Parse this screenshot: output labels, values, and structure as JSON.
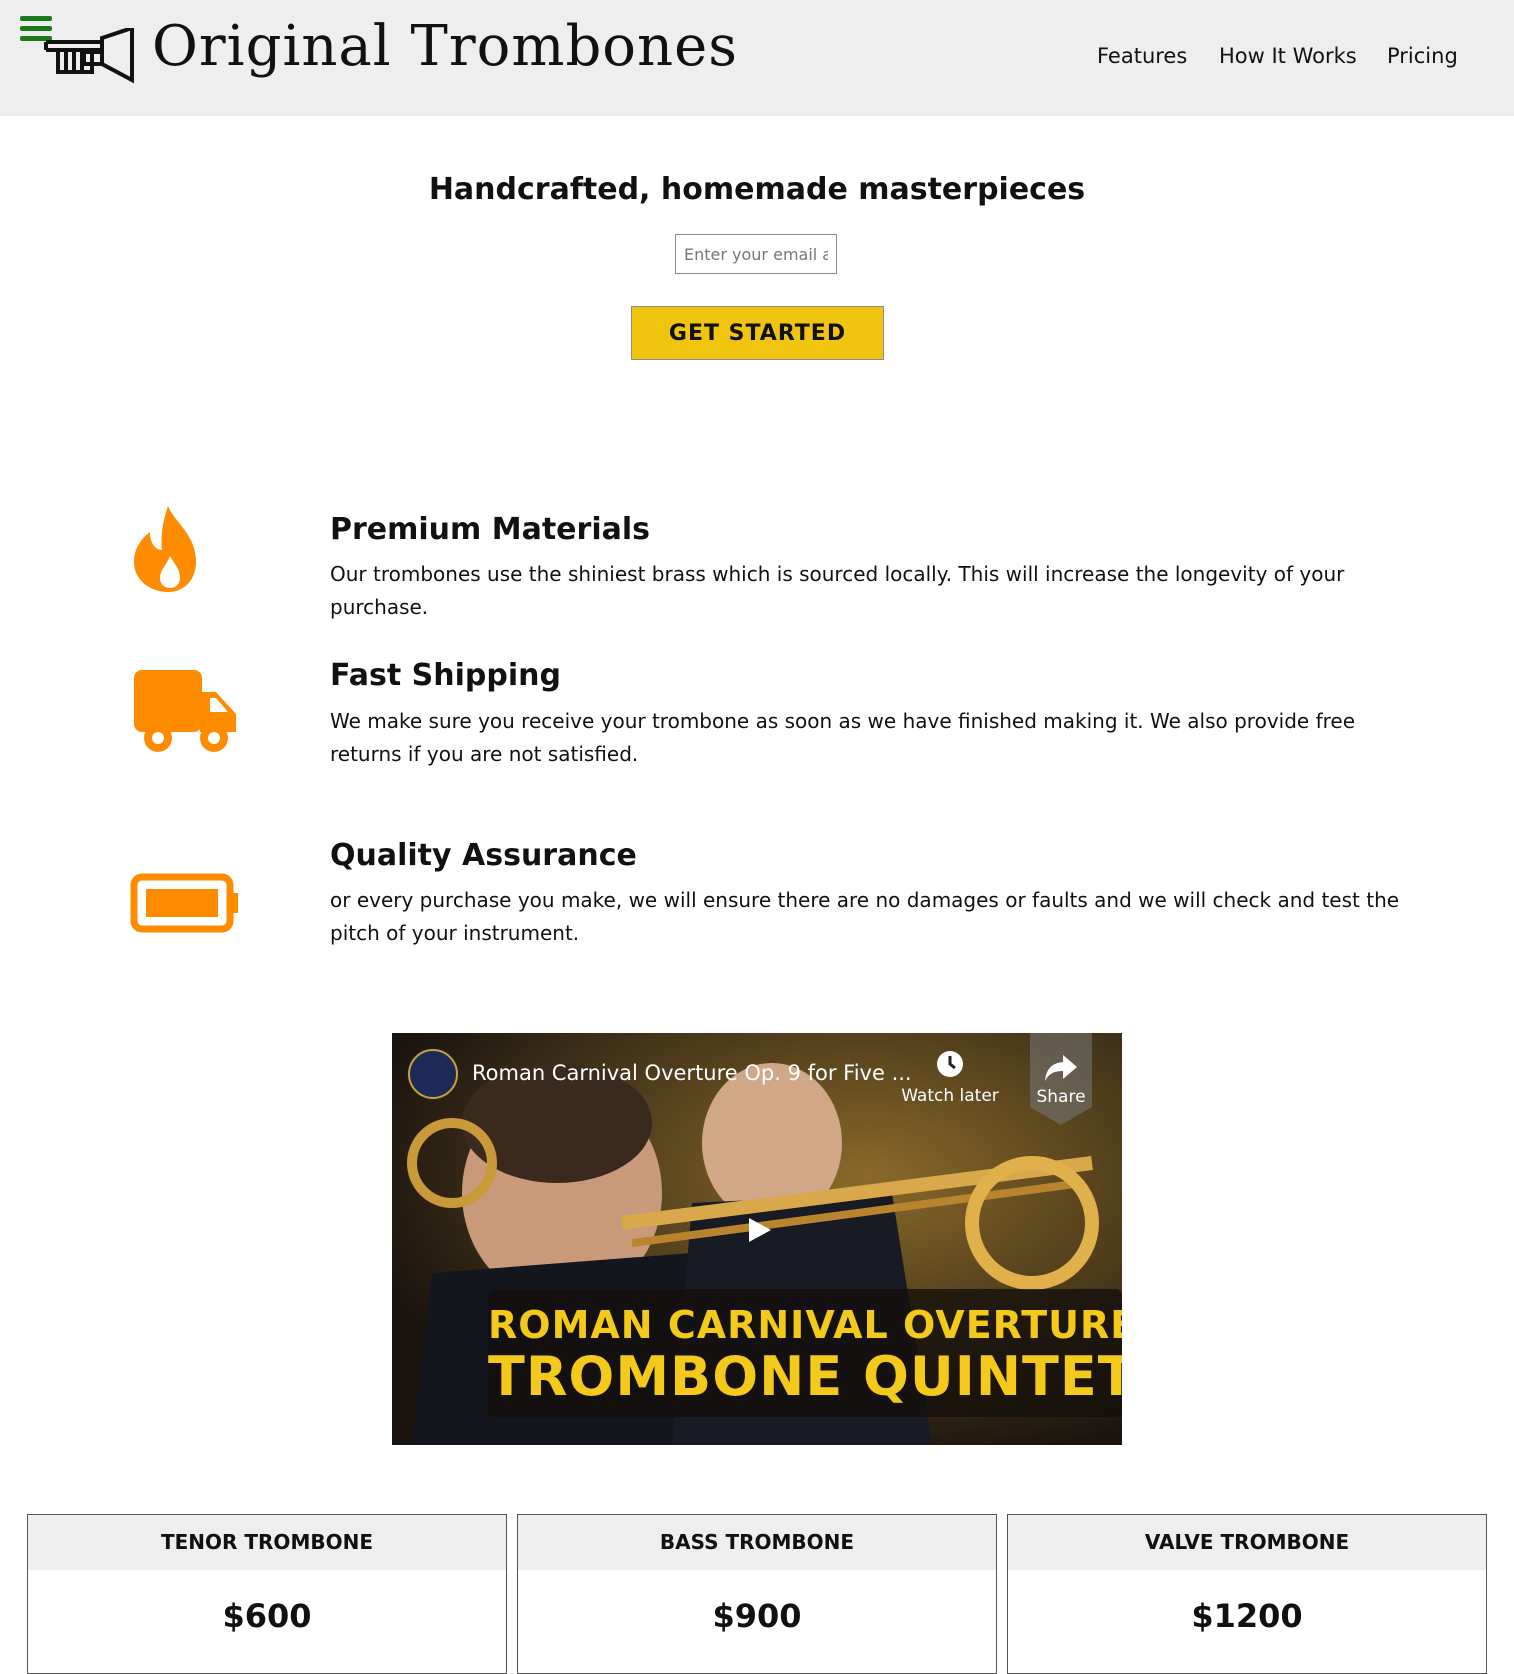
{
  "header": {
    "brand": "Original Trombones",
    "nav": [
      "Features",
      "How It Works",
      "Pricing"
    ]
  },
  "hero": {
    "title": "Handcrafted, homemade masterpieces",
    "email_placeholder": "Enter your email address",
    "cta_label": "GET STARTED"
  },
  "features": [
    {
      "icon": "fire-icon",
      "title": "Premium Materials",
      "text": "Our trombones use the shiniest brass which is sourced locally. This will increase the longevity of your purchase."
    },
    {
      "icon": "truck-icon",
      "title": "Fast Shipping",
      "text": "We make sure you receive your trombone as soon as we have finished making it. We also provide free returns if you are not satisfied."
    },
    {
      "icon": "battery-icon",
      "title": "Quality Assurance",
      "text": "or every purchase you make, we will ensure there are no damages or faults and we will check and test the pitch of your instrument."
    }
  ],
  "video": {
    "title": "Roman Carnival Overture Op. 9 for Five ...",
    "watch_later": "Watch later",
    "share": "Share",
    "banner_line1": "ROMAN CARNIVAL OVERTURE",
    "banner_line2": "TROMBONE QUINTET"
  },
  "pricing": [
    {
      "name": "TENOR TROMBONE",
      "price": "$600"
    },
    {
      "name": "BASS TROMBONE",
      "price": "$900"
    },
    {
      "name": "VALVE TROMBONE",
      "price": "$1200"
    }
  ],
  "colors": {
    "header_bg": "#eeeeee",
    "accent_orange": "#ff8c00",
    "cta_yellow": "#f1c40f",
    "menu_green": "#1a7a1a",
    "banner_yellow": "#f3c91c"
  }
}
